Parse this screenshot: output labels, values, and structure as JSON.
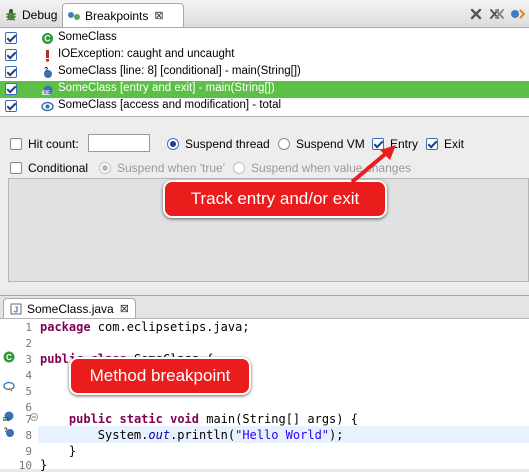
{
  "tabs": {
    "debug_label": "Debug",
    "breakpoints_label": "Breakpoints",
    "close_glyph": "⊠"
  },
  "toolbar": {
    "remove_icon": "remove-icon",
    "remove_all_icon": "remove-all-icon",
    "skip_icon": "skip-all-breakpoints-icon"
  },
  "breakpoints": [
    {
      "label": "SomeClass",
      "checked": true,
      "icon": "class-icon",
      "selected": false
    },
    {
      "label": "IOException: caught and uncaught",
      "checked": true,
      "icon": "exception-icon",
      "selected": false
    },
    {
      "label": "SomeClass [line: 8] [conditional] - main(String[])",
      "checked": true,
      "icon": "conditional-breakpoint-icon",
      "selected": false
    },
    {
      "label": "SomeClass [entry and exit] - main(String[])",
      "checked": true,
      "icon": "method-breakpoint-icon",
      "selected": true
    },
    {
      "label": "SomeClass [access and modification] - total",
      "checked": true,
      "icon": "watchpoint-icon",
      "selected": false
    }
  ],
  "settings": {
    "hit_count_label": "Hit count:",
    "hit_count_value": "",
    "suspend_thread_label": "Suspend thread",
    "suspend_vm_label": "Suspend VM",
    "entry_label": "Entry",
    "exit_label": "Exit",
    "conditional_label": "Conditional",
    "suspend_true_label": "Suspend when 'true'",
    "suspend_changes_label": "Suspend when value changes"
  },
  "callouts": {
    "track": "Track entry and/or exit",
    "method": "Method breakpoint"
  },
  "editor": {
    "file_tab": "SomeClass.java",
    "close_glyph": "⊠",
    "lines": [
      {
        "n": "1",
        "text": "package com.eclipsetips.java;"
      },
      {
        "n": "2",
        "text": ""
      },
      {
        "n": "3",
        "text": "public class SomeClass {"
      },
      {
        "n": "4",
        "text": ""
      },
      {
        "n": "5",
        "text": ""
      },
      {
        "n": "6",
        "text": ""
      },
      {
        "n": "7",
        "text": "public static void main(String[] args) {"
      },
      {
        "n": "8",
        "text": "System.out.println(\"Hello World\");"
      },
      {
        "n": "9",
        "text": "}"
      },
      {
        "n": "10",
        "text": "}"
      }
    ]
  },
  "colors": {
    "selection": "#5cc046",
    "callout": "#ea1c1c",
    "keyword": "#7f0055",
    "string": "#2a00ff"
  }
}
